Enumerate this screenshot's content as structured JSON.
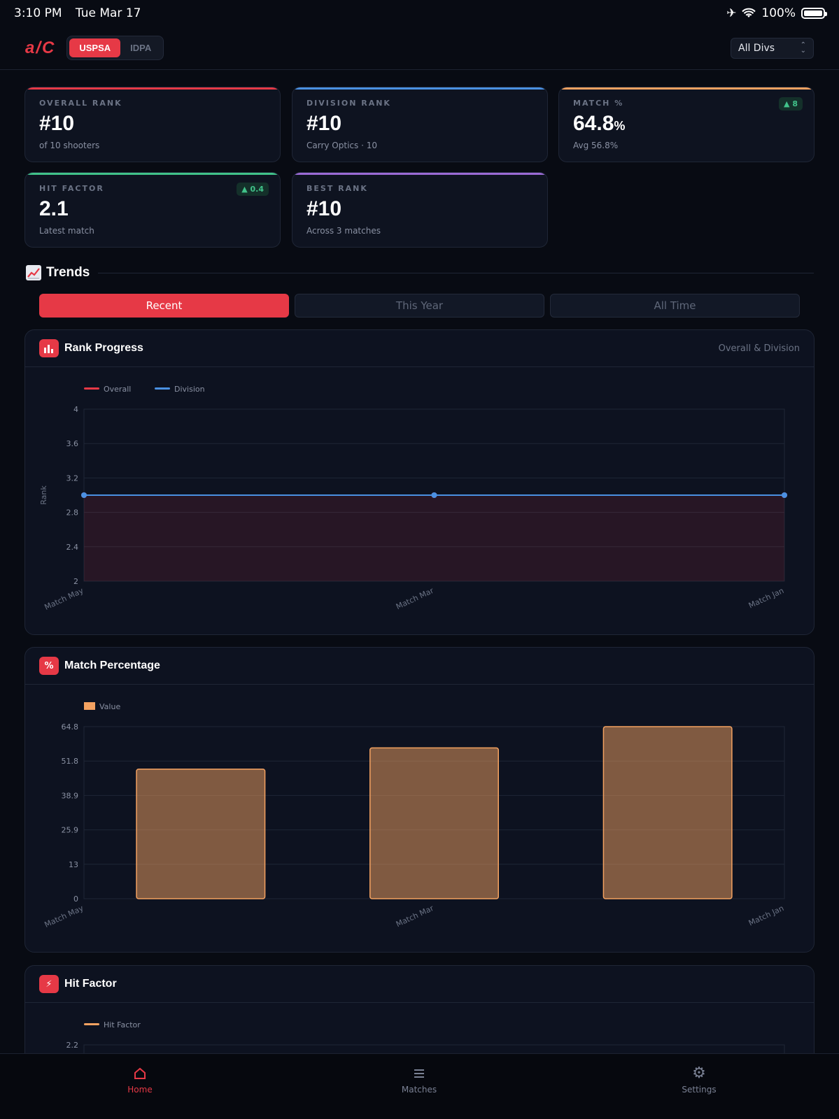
{
  "status": {
    "time": "3:10 PM",
    "date": "Tue Mar 17",
    "battery": "100%"
  },
  "header": {
    "logo": "a/C",
    "sports": [
      {
        "label": "USPSA",
        "active": true
      },
      {
        "label": "IDPA",
        "active": false
      }
    ],
    "division_select": "All Divs"
  },
  "stats": [
    {
      "label": "OVERALL RANK",
      "value": "#10",
      "unit": "",
      "sub": "of 10 shooters",
      "delta": "",
      "accent": "#e63946"
    },
    {
      "label": "DIVISION RANK",
      "value": "#10",
      "unit": "",
      "sub": "Carry Optics · 10",
      "delta": "",
      "accent": "#4a90e2"
    },
    {
      "label": "MATCH %",
      "value": "64.8",
      "unit": "%",
      "sub": "Avg 56.8%",
      "delta": "▲ 8",
      "accent": "#f4a261"
    },
    {
      "label": "HIT FACTOR",
      "value": "2.1",
      "unit": "",
      "sub": "Latest match",
      "delta": "▲ 0.4",
      "accent": "#41c28a"
    },
    {
      "label": "BEST RANK",
      "value": "#10",
      "unit": "",
      "sub": "Across 3 matches",
      "delta": "",
      "accent": "#9b6bd6"
    }
  ],
  "trends": {
    "title": "Trends",
    "icon": "chart-increasing-icon",
    "ranges": [
      {
        "label": "Recent",
        "active": true
      },
      {
        "label": "This Year",
        "active": false
      },
      {
        "label": "All Time",
        "active": false
      }
    ]
  },
  "charts": {
    "rank": {
      "icon_glyph": "▮▮",
      "title": "Rank Progress",
      "subtitle": "Overall & Division"
    },
    "match": {
      "icon_glyph": "%",
      "title": "Match Percentage"
    },
    "hf": {
      "icon_glyph": "⚡",
      "title": "Hit Factor"
    }
  },
  "tabbar": [
    {
      "label": "Home",
      "icon": "home-icon",
      "active": true
    },
    {
      "label": "Matches",
      "icon": "list-icon",
      "active": false
    },
    {
      "label": "Settings",
      "icon": "gear-icon",
      "active": false
    }
  ],
  "chart_data": [
    {
      "type": "line",
      "title": "Rank Progress",
      "ylabel": "Rank",
      "categories": [
        "Match May",
        "Match Mar",
        "Match Jan"
      ],
      "series": [
        {
          "name": "Overall",
          "color": "#e63946",
          "values": [
            3,
            3,
            3
          ]
        },
        {
          "name": "Division",
          "color": "#4a90e2",
          "values": [
            3,
            3,
            3
          ]
        }
      ],
      "ylim": [
        2,
        4
      ],
      "yticks": [
        "4",
        "3.6",
        "3.2",
        "2.8",
        "2.4",
        "2"
      ],
      "legend": "top-left",
      "grid": true
    },
    {
      "type": "bar",
      "title": "Match Percentage",
      "categories": [
        "Match May",
        "Match Mar",
        "Match Jan"
      ],
      "series": [
        {
          "name": "Value",
          "color": "#f4a261",
          "values": [
            48.8,
            56.8,
            64.8
          ]
        }
      ],
      "ylim": [
        0,
        64.8
      ],
      "yticks": [
        "64.8",
        "51.8",
        "38.9",
        "25.9",
        "13",
        "0"
      ],
      "legend": "top-left",
      "grid": true
    },
    {
      "type": "line",
      "title": "Hit Factor",
      "categories": [
        "Match May",
        "Match Mar",
        "Match Jan"
      ],
      "series": [
        {
          "name": "Hit Factor",
          "color": "#f4a261",
          "values": []
        }
      ],
      "yticks": [
        "2.2"
      ],
      "legend": "top-left",
      "grid": true
    }
  ]
}
